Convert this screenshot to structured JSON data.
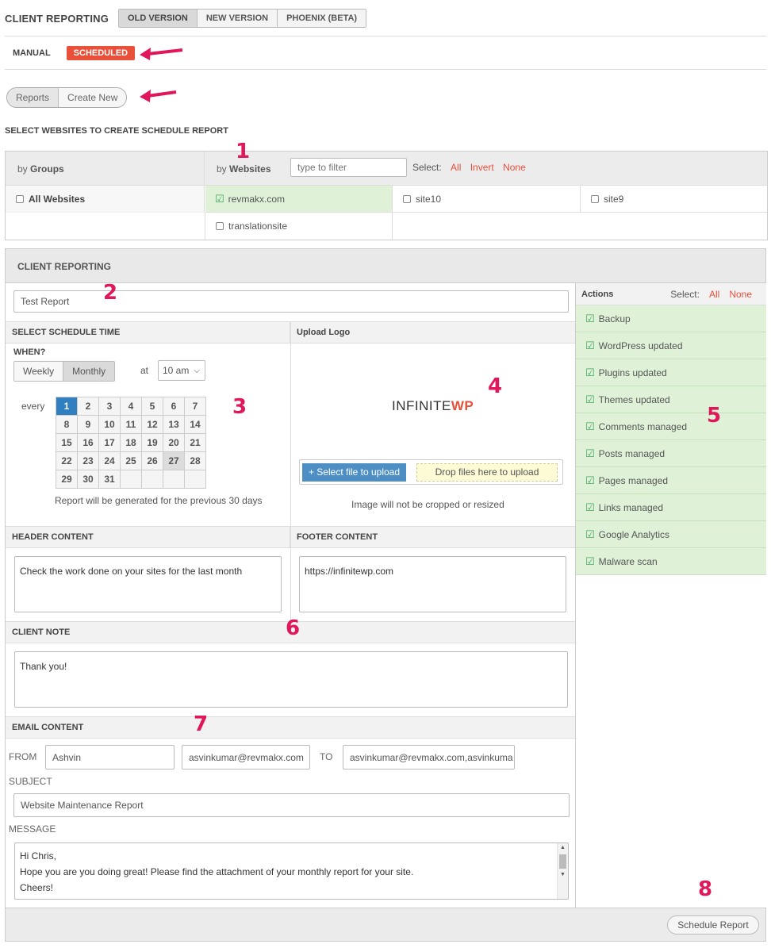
{
  "top": {
    "title": "CLIENT REPORTING",
    "versions": [
      "OLD VERSION",
      "NEW VERSION",
      "PHOENIX (BETA)"
    ],
    "manual": "MANUAL",
    "scheduled": "SCHEDULED",
    "reports": "Reports",
    "create_new": "Create New"
  },
  "select_heading": "SELECT WEBSITES TO CREATE SCHEDULE REPORT",
  "sites": {
    "by_groups_prefix": "by",
    "by_groups": "Groups",
    "by_websites_prefix": "by",
    "by_websites": "Websites",
    "filter_placeholder": "type to filter",
    "select_label": "Select:",
    "all": "All",
    "invert": "Invert",
    "none": "None",
    "all_websites": "All Websites",
    "list": [
      "revmakx.com",
      "site10",
      "site9",
      "translationsite"
    ]
  },
  "panel": {
    "title": "CLIENT REPORTING",
    "report_name": "Test Report",
    "schedule_time": "SELECT SCHEDULE TIME",
    "when": "WHEN?",
    "weekly": "Weekly",
    "monthly": "Monthly",
    "at": "at",
    "time": "10 am",
    "every": "every",
    "days": [
      "1",
      "2",
      "3",
      "4",
      "5",
      "6",
      "7",
      "8",
      "9",
      "10",
      "11",
      "12",
      "13",
      "14",
      "15",
      "16",
      "17",
      "18",
      "19",
      "20",
      "21",
      "22",
      "23",
      "24",
      "25",
      "26",
      "27",
      "28",
      "29",
      "30",
      "31"
    ],
    "generated_note": "Report will be generated for the previous 30 days",
    "upload_logo": "Upload Logo",
    "logo_text_1": "INFINITE",
    "logo_text_2": "WP",
    "select_file": "+ Select file to upload",
    "drop_files": "Drop files here to upload",
    "image_note": "Image will not be cropped or resized",
    "header_content": "HEADER CONTENT",
    "header_text": "Check the work done on your sites for the last month",
    "footer_content": "FOOTER CONTENT",
    "footer_text": "https://infinitewp.com",
    "client_note": "CLIENT NOTE",
    "client_note_text": "Thank you!",
    "email_content": "EMAIL CONTENT",
    "from": "FROM",
    "from_name": "Ashvin",
    "from_email": "asvinkumar@revmakx.com",
    "to": "TO",
    "to_email": "asvinkumar@revmakx.com,asvinkuma",
    "subject": "SUBJECT",
    "subject_text": "Website Maintenance Report",
    "message": "MESSAGE",
    "message_lines": [
      "Hi Chris,",
      "Hope you are you doing great! Please find the attachment of your monthly report for your site.",
      "Cheers!"
    ],
    "schedule_button": "Schedule Report"
  },
  "actions": {
    "title": "Actions",
    "select_label": "Select:",
    "all": "All",
    "none": "None",
    "items": [
      "Backup",
      "WordPress updated",
      "Plugins updated",
      "Themes updated",
      "Comments managed",
      "Posts managed",
      "Pages managed",
      "Links managed",
      "Google Analytics",
      "Malware scan"
    ]
  },
  "annotations": [
    "1",
    "2",
    "3",
    "4",
    "5",
    "6",
    "7",
    "8"
  ],
  "colors": {
    "accent_red": "#e8503a",
    "annotation": "#e0185b",
    "check_green": "#3fa55a",
    "selected_blue": "#2f7fc1"
  }
}
